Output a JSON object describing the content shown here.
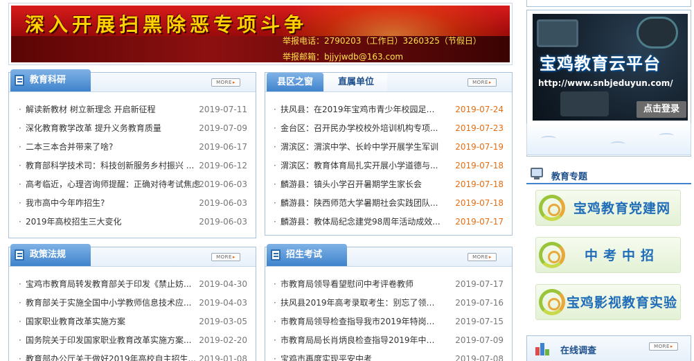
{
  "banner": {
    "title": "深入开展扫黑除恶专项斗争",
    "phone": "举报电话：2790203（工作日）3260325（节假日）",
    "mail": "举报邮箱：bjjyjwdb@163.com"
  },
  "more_label": "MORE",
  "jyky": {
    "title": "教育科研",
    "items": [
      {
        "title": "解读新教材 树立新理念 开启新征程",
        "date": "2019-07-11"
      },
      {
        "title": "深化教育教学改革 提升义务教育质量",
        "date": "2019-07-09"
      },
      {
        "title": "二本三本合并带来了啥?",
        "date": "2019-06-17"
      },
      {
        "title": "教育部科学技术司：科技创新服务乡村振兴 ...",
        "date": "2019-06-12"
      },
      {
        "title": "高考临近，心理咨询师提醒：正确对待考试焦虑",
        "date": "2019-06-03"
      },
      {
        "title": "我市高中今年咋招生?",
        "date": "2019-06-03"
      },
      {
        "title": "2019年高校招生三大变化",
        "date": "2019-06-03"
      }
    ]
  },
  "xqzc": {
    "tab_active": "县区之窗",
    "tab_inactive": "直属单位",
    "items": [
      {
        "title": "扶风县：在2019年宝鸡市青少年校园足球...",
        "date": "2019-07-24"
      },
      {
        "title": "金台区：召开民办学校校外培训机构专项...",
        "date": "2019-07-23"
      },
      {
        "title": "渭滨区：渭滨中学、长岭中学开展学生军训",
        "date": "2019-07-19"
      },
      {
        "title": "渭滨区：教育体育局扎实开展小学道德与...",
        "date": "2019-07-18"
      },
      {
        "title": "麟游县：镇头小学召开暑期学生家长会",
        "date": "2019-07-18"
      },
      {
        "title": "麟游县：陕西师范大学暑期社会实践团队...",
        "date": "2019-07-18"
      },
      {
        "title": "麟游县：教体局纪念建党98周年活动成效...",
        "date": "2019-07-17"
      }
    ]
  },
  "zcfg": {
    "title": "政策法规",
    "items": [
      {
        "title": "宝鸡市教育局转发教育部关于印发《禁止妨...",
        "date": "2019-04-30"
      },
      {
        "title": "教育部关于实施全国中小学教师信息技术应...",
        "date": "2019-04-03"
      },
      {
        "title": "国家职业教育改革实施方案",
        "date": "2019-03-05"
      },
      {
        "title": "国务院关于印发国家职业教育改革实施方案...",
        "date": "2019-02-20"
      },
      {
        "title": "教育部办公厅关于做好2019年高校自主招生...",
        "date": "2019-01-08"
      }
    ]
  },
  "zsks": {
    "title": "招生考试",
    "items": [
      {
        "title": "市教育局领导看望慰问中考评卷教师",
        "date": "2019-07-17"
      },
      {
        "title": "扶风县2019年高考录取考生：别忘了领取你...",
        "date": "2019-07-16"
      },
      {
        "title": "市教育局领导检查指导我市2019年特岗教师...",
        "date": "2019-07-15"
      },
      {
        "title": "市教育局局长肖炳良检查指导2019年中考评...",
        "date": "2019-07-09"
      },
      {
        "title": "宝鸡市再度实现平安中考",
        "date": "2019-07-08"
      }
    ]
  },
  "cloud": {
    "title": "宝鸡教育云平台",
    "url": "http://www.snbjeduyun.com/",
    "login": "点击登录"
  },
  "topic": {
    "title": "教育专题",
    "promos": [
      "宝鸡教育党建网",
      "中考中招",
      "宝鸡影视教育实验"
    ]
  },
  "survey": {
    "title": "在线调查"
  }
}
